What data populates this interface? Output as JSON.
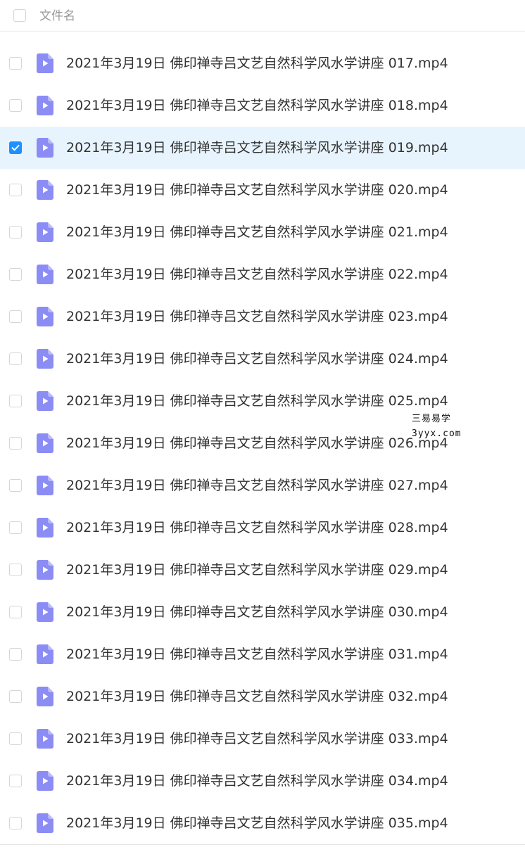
{
  "header": {
    "column_label": "文件名",
    "select_all_checked": false
  },
  "colors": {
    "accent": "#1e90ff",
    "selected_row_bg": "#e8f4fd",
    "video_icon": "#8c8cf5"
  },
  "files": [
    {
      "name": "2021年3月19日 佛印禅寺吕文艺自然科学风水学讲座 017.mp4",
      "icon": "video-file-icon",
      "checked": false
    },
    {
      "name": "2021年3月19日 佛印禅寺吕文艺自然科学风水学讲座 018.mp4",
      "icon": "video-file-icon",
      "checked": false
    },
    {
      "name": "2021年3月19日 佛印禅寺吕文艺自然科学风水学讲座 019.mp4",
      "icon": "video-file-icon",
      "checked": true
    },
    {
      "name": "2021年3月19日 佛印禅寺吕文艺自然科学风水学讲座 020.mp4",
      "icon": "video-file-icon",
      "checked": false
    },
    {
      "name": "2021年3月19日 佛印禅寺吕文艺自然科学风水学讲座 021.mp4",
      "icon": "video-file-icon",
      "checked": false
    },
    {
      "name": "2021年3月19日 佛印禅寺吕文艺自然科学风水学讲座 022.mp4",
      "icon": "video-file-icon",
      "checked": false
    },
    {
      "name": "2021年3月19日 佛印禅寺吕文艺自然科学风水学讲座 023.mp4",
      "icon": "video-file-icon",
      "checked": false
    },
    {
      "name": "2021年3月19日 佛印禅寺吕文艺自然科学风水学讲座 024.mp4",
      "icon": "video-file-icon",
      "checked": false
    },
    {
      "name": "2021年3月19日 佛印禅寺吕文艺自然科学风水学讲座 025.mp4",
      "icon": "video-file-icon",
      "checked": false
    },
    {
      "name": "2021年3月19日 佛印禅寺吕文艺自然科学风水学讲座 026.mp4",
      "icon": "video-file-icon",
      "checked": false
    },
    {
      "name": "2021年3月19日 佛印禅寺吕文艺自然科学风水学讲座 027.mp4",
      "icon": "video-file-icon",
      "checked": false
    },
    {
      "name": "2021年3月19日 佛印禅寺吕文艺自然科学风水学讲座 028.mp4",
      "icon": "video-file-icon",
      "checked": false
    },
    {
      "name": "2021年3月19日 佛印禅寺吕文艺自然科学风水学讲座 029.mp4",
      "icon": "video-file-icon",
      "checked": false
    },
    {
      "name": "2021年3月19日 佛印禅寺吕文艺自然科学风水学讲座 030.mp4",
      "icon": "video-file-icon",
      "checked": false
    },
    {
      "name": "2021年3月19日 佛印禅寺吕文艺自然科学风水学讲座 031.mp4",
      "icon": "video-file-icon",
      "checked": false
    },
    {
      "name": "2021年3月19日 佛印禅寺吕文艺自然科学风水学讲座 032.mp4",
      "icon": "video-file-icon",
      "checked": false
    },
    {
      "name": "2021年3月19日 佛印禅寺吕文艺自然科学风水学讲座 033.mp4",
      "icon": "video-file-icon",
      "checked": false
    },
    {
      "name": "2021年3月19日 佛印禅寺吕文艺自然科学风水学讲座 034.mp4",
      "icon": "video-file-icon",
      "checked": false
    },
    {
      "name": "2021年3月19日 佛印禅寺吕文艺自然科学风水学讲座 035.mp4",
      "icon": "video-file-icon",
      "checked": false
    }
  ],
  "watermark": {
    "line1": "三易易学",
    "line2": "3yyx.com"
  }
}
